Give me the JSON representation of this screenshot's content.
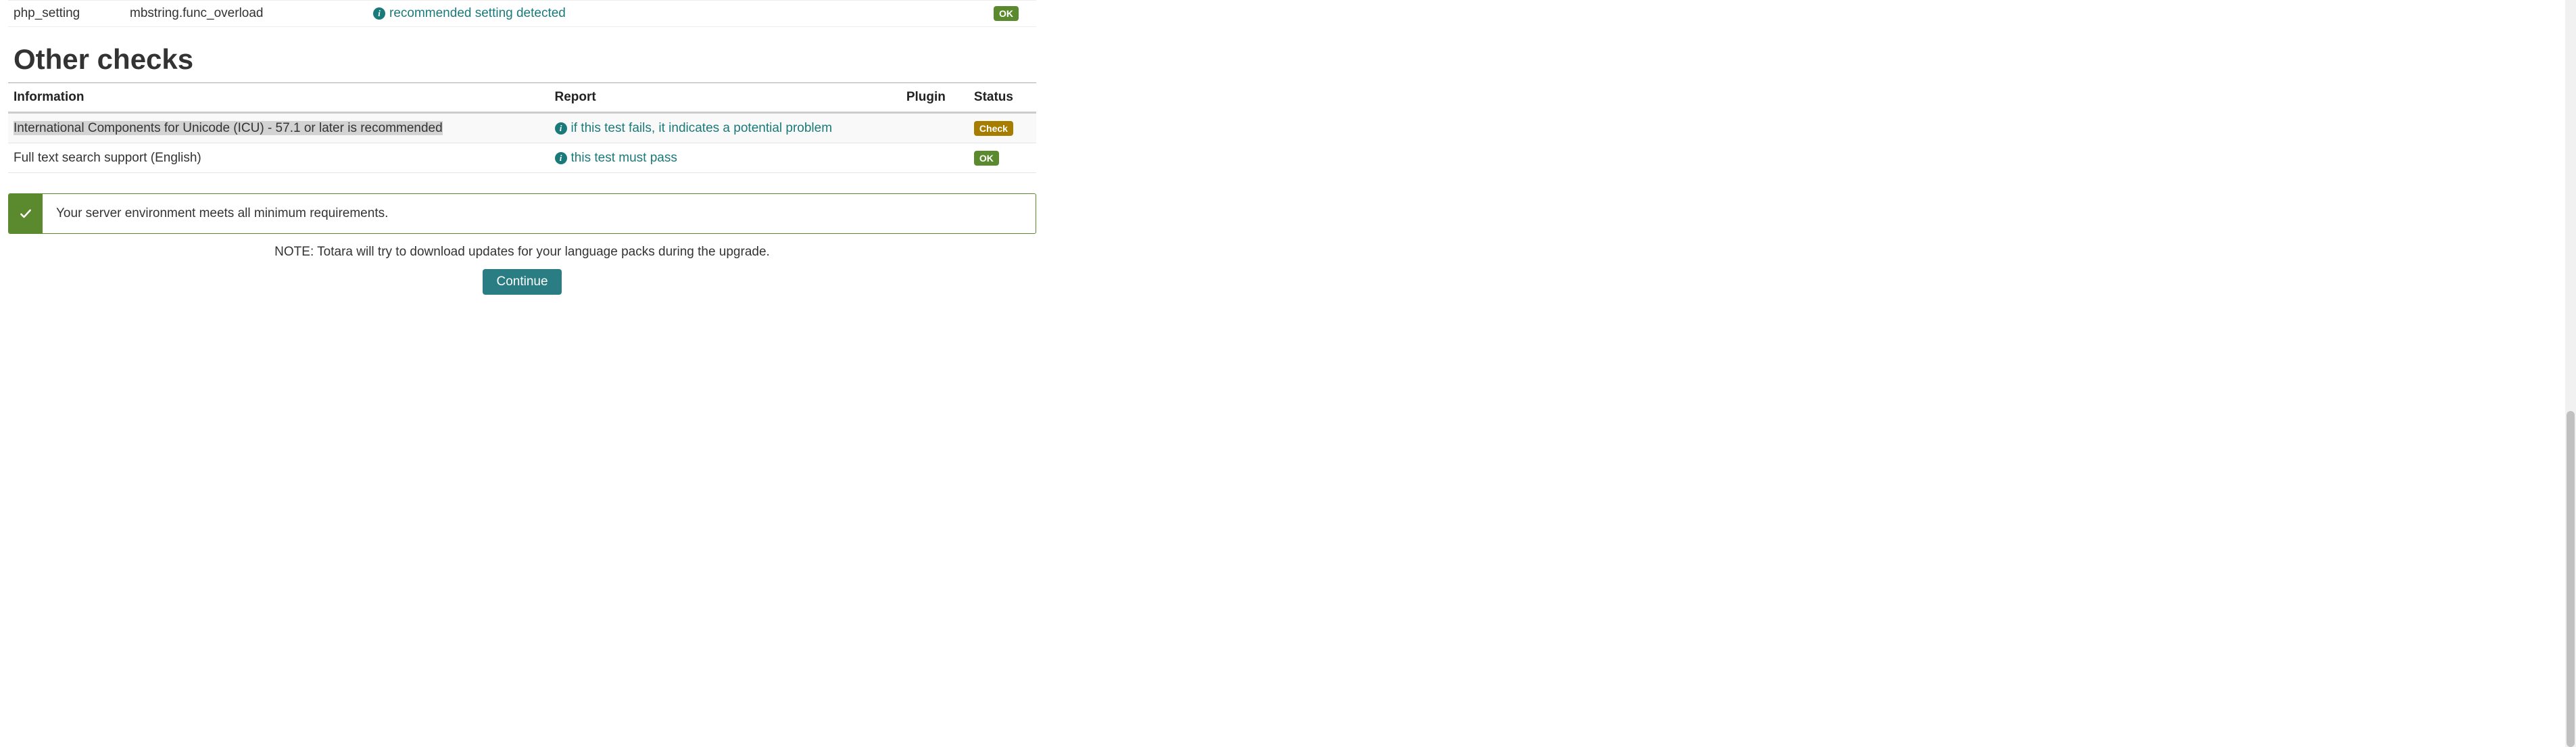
{
  "topRow": {
    "type": "php_setting",
    "name": "mbstring.func_overload",
    "report": "recommended setting detected",
    "statusLabel": "OK",
    "statusKind": "ok"
  },
  "sectionTitle": "Other checks",
  "headers": {
    "information": "Information",
    "report": "Report",
    "plugin": "Plugin",
    "status": "Status"
  },
  "rows": [
    {
      "information": "International Components for Unicode (ICU) - 57.1 or later is recommended",
      "highlighted": true,
      "report": "if this test fails, it indicates a potential problem",
      "plugin": "",
      "statusLabel": "Check",
      "statusKind": "check"
    },
    {
      "information": "Full text search support (English)",
      "highlighted": false,
      "report": "this test must pass",
      "plugin": "",
      "statusLabel": "OK",
      "statusKind": "ok"
    }
  ],
  "alert": {
    "message": "Your server environment meets all minimum requirements."
  },
  "note": "NOTE: Totara will try to download updates for your language packs during the upgrade.",
  "continueLabel": "Continue"
}
